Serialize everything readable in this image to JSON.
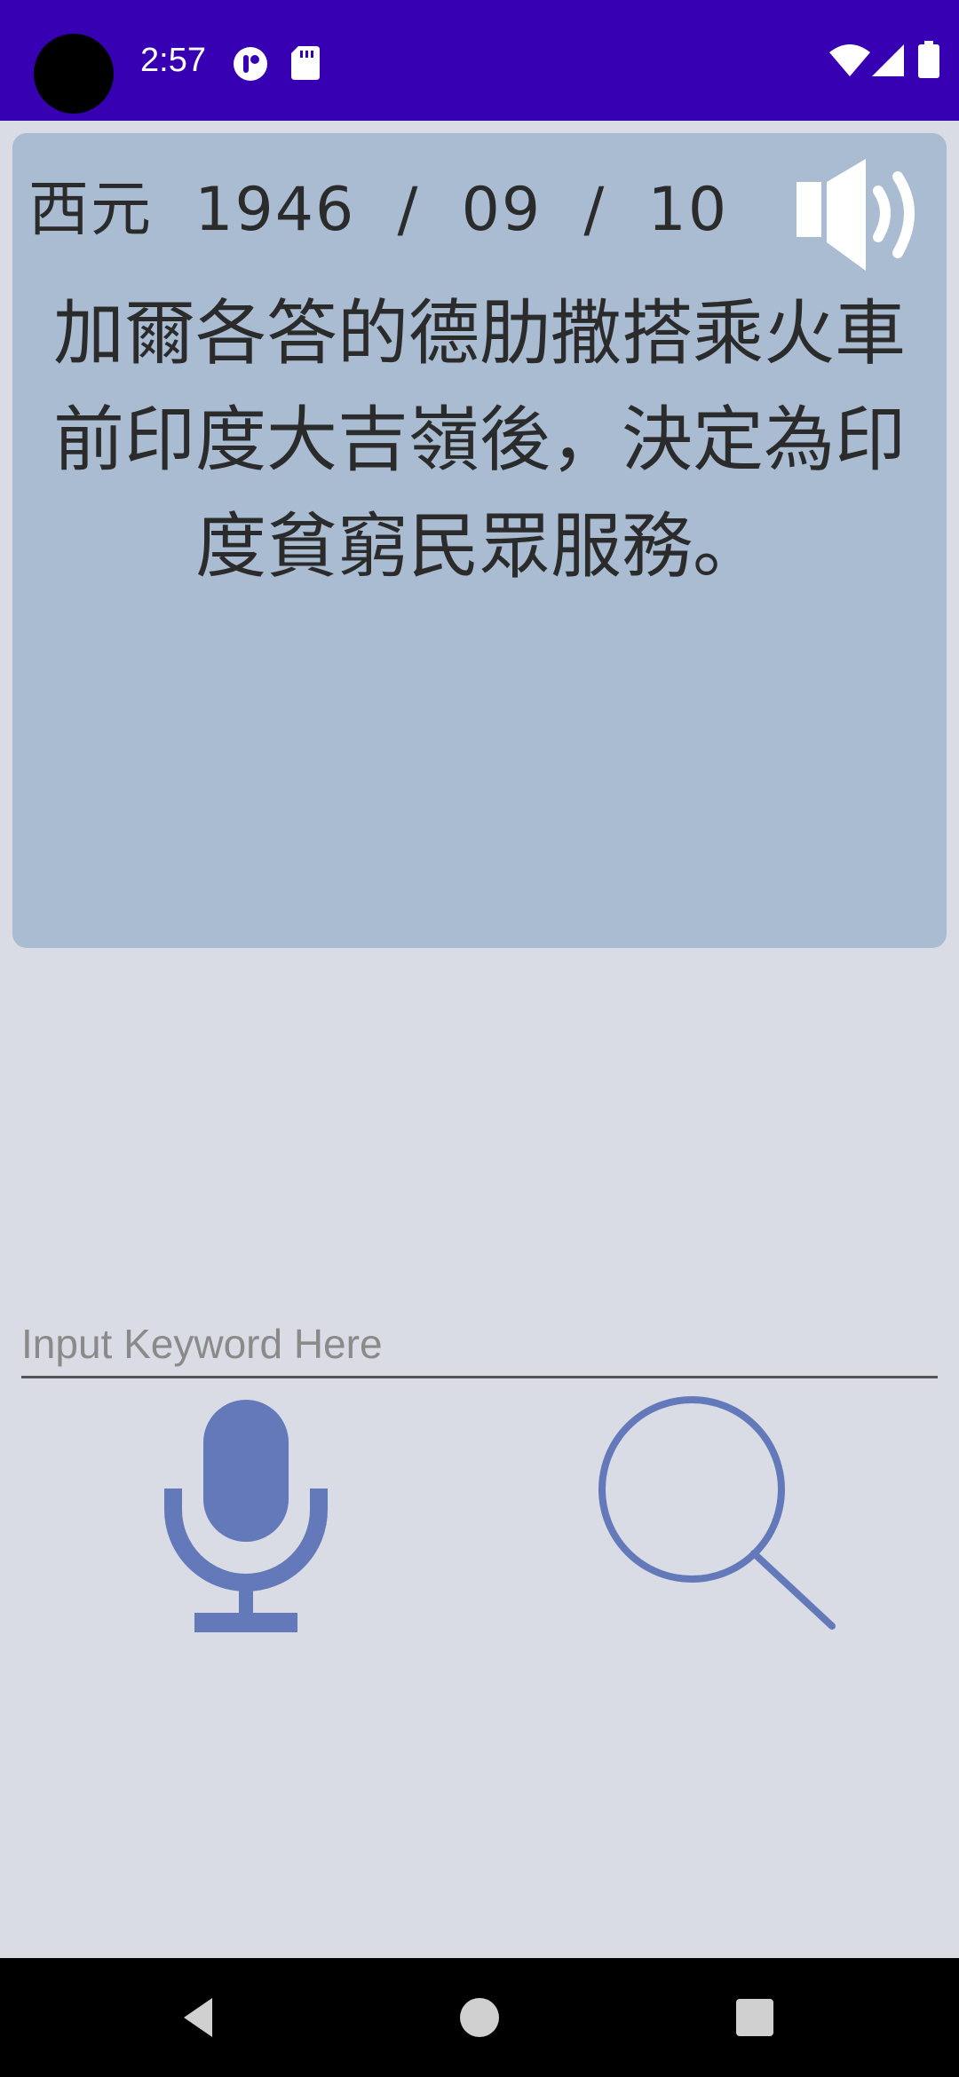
{
  "status_bar": {
    "time": "2:57",
    "left_icons": [
      "app-notification-icon",
      "sd-card-icon"
    ],
    "right_icons": [
      "wifi-icon",
      "cell-signal-icon",
      "battery-icon"
    ],
    "background_color": "#3700b3"
  },
  "event_card": {
    "date_text": "西元  1946  /  09  /  10",
    "event_text": "加爾各答的德肋撒搭乘火車前印度大吉嶺後，決定為印度貧窮民眾服務。",
    "speaker_icon": "speaker-volume-icon",
    "background_color": "#a9bcd2"
  },
  "search": {
    "placeholder": "Input Keyword Here",
    "value": ""
  },
  "actions": {
    "mic_icon": "microphone-icon",
    "search_icon": "search-icon",
    "icon_color": "#6379b9"
  },
  "nav_bar": {
    "buttons": [
      "back-icon",
      "home-icon",
      "recents-icon"
    ]
  }
}
